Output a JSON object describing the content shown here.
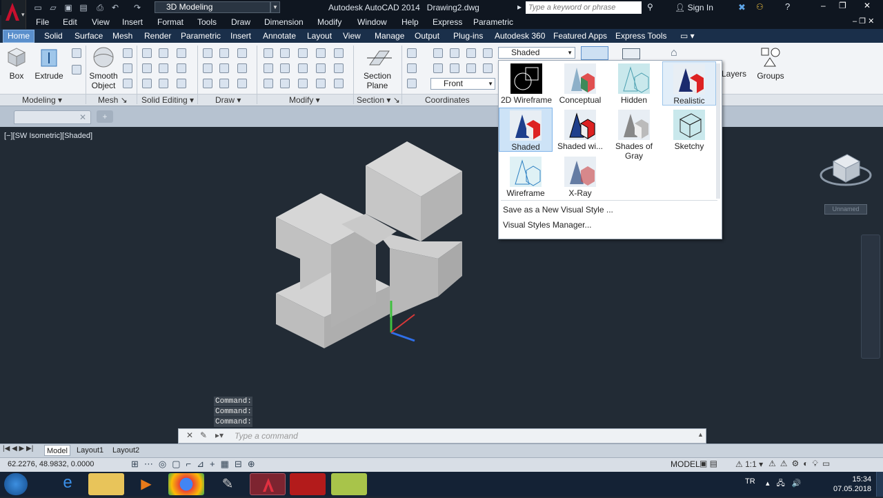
{
  "title_bar": {
    "workspace": "3D Modeling",
    "app_title": "Autodesk AutoCAD 2014",
    "document": "Drawing2.dwg",
    "search_placeholder": "Type a keyword or phrase",
    "sign_in": "Sign In"
  },
  "menus": [
    "File",
    "Edit",
    "View",
    "Insert",
    "Format",
    "Tools",
    "Draw",
    "Dimension",
    "Modify",
    "Window",
    "Help",
    "Express",
    "Parametric"
  ],
  "ribbon_tabs": [
    "Home",
    "Solid",
    "Surface",
    "Mesh",
    "Render",
    "Parametric",
    "Insert",
    "Annotate",
    "Layout",
    "View",
    "Manage",
    "Output",
    "Plug-ins",
    "Autodesk 360",
    "Featured Apps",
    "Express Tools"
  ],
  "ribbon": {
    "box": "Box",
    "extrude": "Extrude",
    "smooth1": "Smooth",
    "smooth2": "Object",
    "section1": "Section",
    "section2": "Plane",
    "front": "Front",
    "visual_style": "Shaded",
    "layers": "Layers",
    "groups": "Groups",
    "panels": [
      "Modeling",
      "Mesh",
      "Solid Editing",
      "Draw",
      "Modify",
      "Section",
      "Coordinates"
    ]
  },
  "viewport": {
    "label": "[−][SW Isometric][Shaded]",
    "viewcube_label": "Unnamed"
  },
  "visual_styles": {
    "items": [
      "2D Wireframe",
      "Conceptual",
      "Hidden",
      "Realistic",
      "Shaded",
      "Shaded wi...",
      "Shades of Gray",
      "Sketchy",
      "Wireframe",
      "X-Ray"
    ],
    "save_as": "Save as a New Visual Style ...",
    "manager": "Visual Styles Manager...",
    "selected": "Shaded",
    "hovered": "Realistic"
  },
  "command_line": {
    "history": [
      "Command:",
      "Command:",
      "Command:"
    ],
    "placeholder": "Type a command"
  },
  "layout_tabs": [
    "Model",
    "Layout1",
    "Layout2"
  ],
  "status": {
    "coordinates": "62.2276, 48.9832, 0.0000",
    "model": "MODEL",
    "scale": "1:1"
  },
  "taskbar": {
    "language": "TR",
    "time": "15:34",
    "date": "07.05.2018"
  },
  "colors": {
    "accent": "#5a8fcc",
    "viewport_bg": "#222b35",
    "taskbar": "#142235"
  }
}
